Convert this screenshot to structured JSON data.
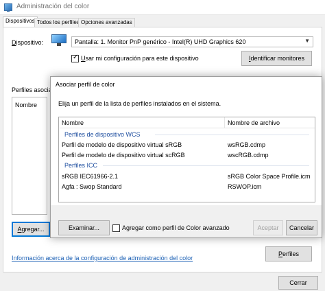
{
  "window": {
    "title": "Administración del color"
  },
  "tabs": [
    {
      "label": "Dispositivos",
      "active": true
    },
    {
      "label": "Todos los perfiles",
      "active": false
    },
    {
      "label": "Opciones avanzadas",
      "active": false
    }
  ],
  "device": {
    "label": "Dispositivo:",
    "selected": "Pantalla: 1. Monitor PnP genérico - Intel(R) UHD Graphics 620",
    "use_my_settings_label": "Usar mi configuración para este dispositivo",
    "use_my_settings_checked": true,
    "identify_button": "Identificar monitores"
  },
  "profiles_section": {
    "label": "Perfiles asociac",
    "column_name": "Nombre",
    "add_button": "Agregar...",
    "profiles_button": "Perfiles"
  },
  "footer": {
    "info_link": "Información acerca de la configuración de administración del color",
    "close_button": "Cerrar"
  },
  "dialog": {
    "title": "Asociar perfil de color",
    "instruction": "Elija un perfil de la lista de perfiles instalados en el sistema.",
    "columns": {
      "name": "Nombre",
      "file": "Nombre de archivo"
    },
    "groups": [
      {
        "name": "Perfiles de dispositivo WCS",
        "items": [
          {
            "name": "Perfil de modelo de dispositivo virtual sRGB",
            "file": "wsRGB.cdmp"
          },
          {
            "name": "Perfil de modelo de dispositivo virtual scRGB",
            "file": "wscRGB.cdmp"
          }
        ]
      },
      {
        "name": "Perfiles ICC",
        "items": [
          {
            "name": "sRGB IEC61966-2.1",
            "file": "sRGB Color Space Profile.icm"
          },
          {
            "name": "Agfa : Swop Standard",
            "file": "RSWOP.icm"
          }
        ]
      }
    ],
    "browse_button": "Examinar...",
    "advanced_label": "Agregar como perfil de Color avanzado",
    "advanced_checked": false,
    "accept_button": "Aceptar",
    "cancel_button": "Cancelar"
  }
}
